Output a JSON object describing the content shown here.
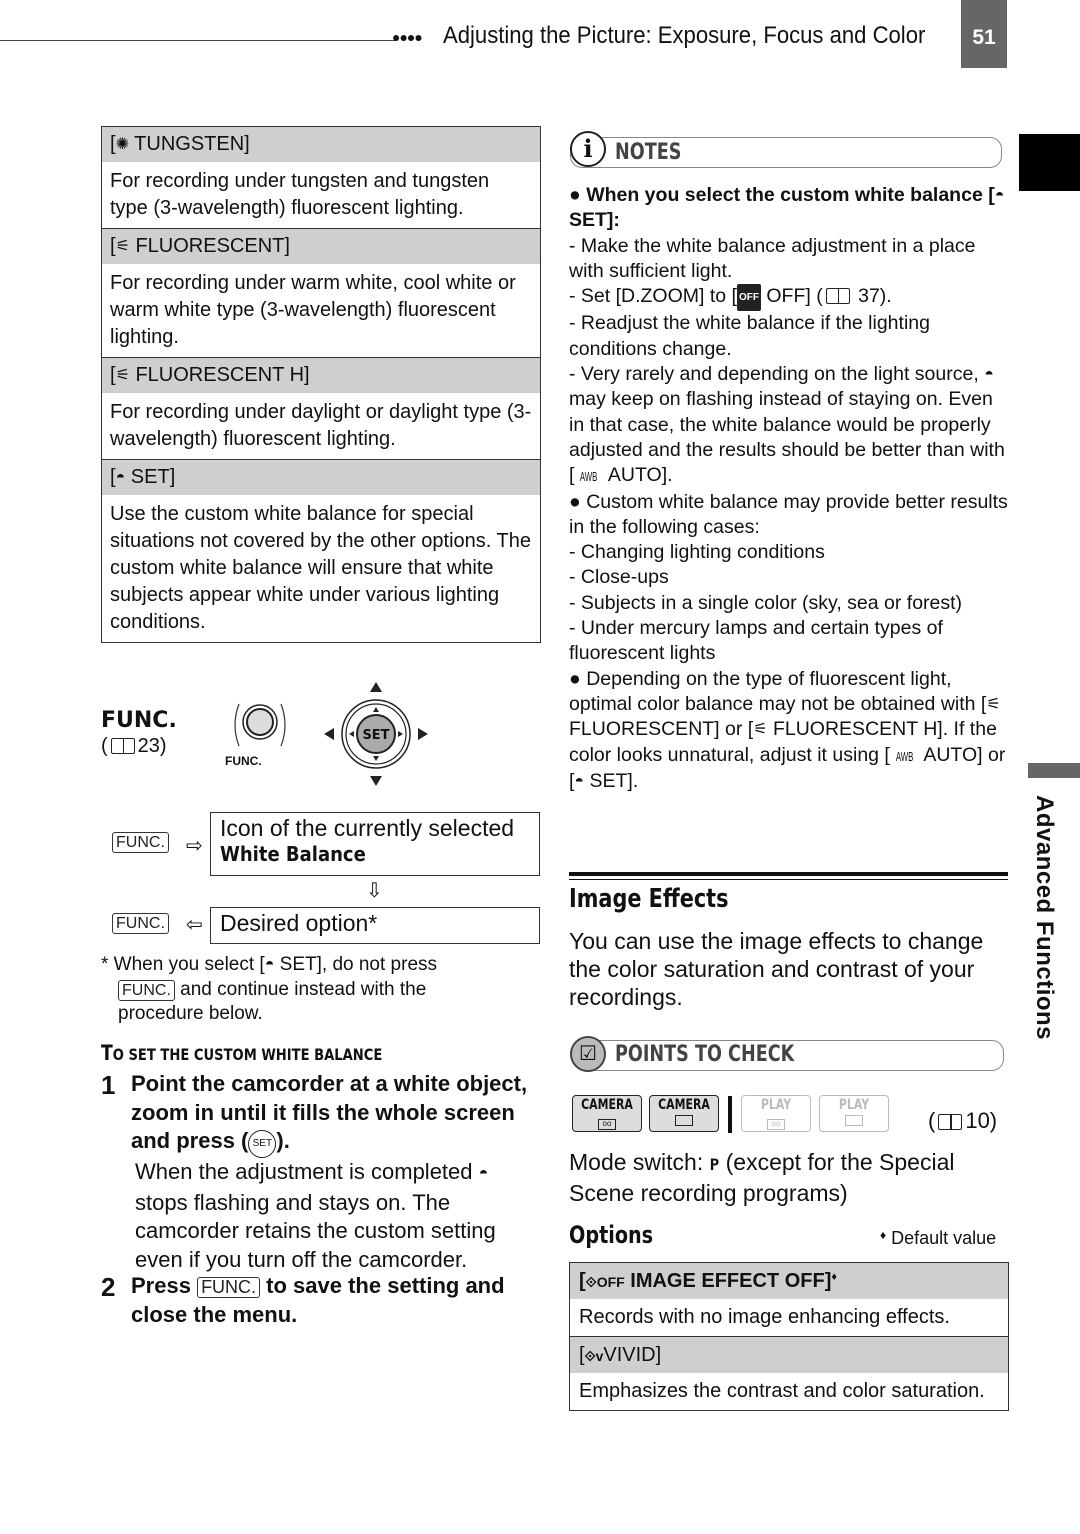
{
  "header": {
    "dots": "●●●●",
    "section_title": "Adjusting the Picture: Exposure, Focus and Color",
    "page_number": "51"
  },
  "side_tab": {
    "label": "Advanced Functions"
  },
  "white_balance_options": [
    {
      "icon": "tungsten-icon",
      "icon_glyph": "✺",
      "label": "TUNGSTEN",
      "description": "For recording under tungsten and tungsten type (3-wavelength) fluorescent lighting."
    },
    {
      "icon": "fluorescent-icon",
      "icon_glyph": "⚟",
      "label": "FLUORESCENT",
      "description": "For recording under warm white, cool white or warm white type (3-wavelength) fluorescent lighting."
    },
    {
      "icon": "fluorescent-h-icon",
      "icon_glyph": "⚟",
      "label": "FLUORESCENT H",
      "description": "For recording under daylight or daylight type (3-wavelength) fluorescent lighting."
    },
    {
      "icon": "custom-wb-icon",
      "icon_glyph": "◓",
      "label": "SET",
      "description": "Use the custom white balance for special situations not covered by the other options. The custom white balance will ensure that white subjects appear white under various lighting conditions."
    }
  ],
  "func_section": {
    "title": "FUNC.",
    "ref_open": "(",
    "ref_page": "23)",
    "func_button_label": "FUNC.",
    "set_label": "SET",
    "flow": {
      "kbd": "FUNC.",
      "box1_line1": "Icon of the currently selected",
      "box1_line2": "White Balance",
      "box2": "Desired option*",
      "arrow_right": "⇨",
      "arrow_down": "⇩",
      "arrow_left": "⇦"
    },
    "footnote_pre": "* When you select [",
    "footnote_mid": " SET], do not press",
    "footnote_kbd": "FUNC.",
    "footnote_post": " and continue instead with the",
    "footnote_end": "procedure below."
  },
  "procedure": {
    "title_big": "T",
    "title_rest": "O SET THE CUSTOM WHITE BALANCE",
    "steps": [
      {
        "num": "1",
        "text_pre": "Point the camcorder at a white object, zoom in until it fills the whole screen and press (",
        "text_set": "SET",
        "text_post": ").",
        "sub_pre": "When the adjustment is completed ",
        "sub_post": " stops flashing and stays on. The camcorder retains the custom setting even if you turn off the camcorder."
      },
      {
        "num": "2",
        "text_pre": "Press ",
        "kbd": "FUNC.",
        "text_post": " to save the setting and close the menu."
      }
    ]
  },
  "notes": {
    "title": "NOTES",
    "items": [
      {
        "type": "bullet-bold",
        "text_pre": "● When you select the custom white balance [",
        "text_post": " SET]:"
      },
      {
        "type": "dash",
        "text": "-  Make the white balance adjustment in a place with sufficient light."
      },
      {
        "type": "dash-off",
        "text_pre": "-  Set [D.ZOOM] to [",
        "off_badge": "OFF",
        "text_mid": " OFF] (",
        "text_post": " 37)."
      },
      {
        "type": "dash",
        "text": "-  Readjust the white balance if the lighting conditions change."
      },
      {
        "type": "dash-icon",
        "text_pre": "-  Very rarely and depending on the light source, ",
        "text_post": " may keep on flashing instead of staying on. Even in that case, the white balance would be properly adjusted and the results should be better than with [",
        "awb": "AWB",
        "text_end": " AUTO]."
      },
      {
        "type": "bullet",
        "text": "● Custom white balance may provide better results in the following cases:"
      },
      {
        "type": "dash",
        "text": "-  Changing lighting conditions"
      },
      {
        "type": "dash",
        "text": "-  Close-ups"
      },
      {
        "type": "dash",
        "text": "-  Subjects in a single color (sky, sea or forest)"
      },
      {
        "type": "dash",
        "text": "-  Under mercury lamps and certain types of fluorescent lights"
      },
      {
        "type": "bullet-fl",
        "text_pre": "● Depending on the type of fluorescent light, optimal color balance may not be obtained with [",
        "fl1": " FLUORESCENT] or [",
        "fl2": " FLUORESCENT H]. If the color looks unnatural, adjust it using [",
        "awb": "AWB",
        "auto": " AUTO] or [",
        "set": " SET]."
      }
    ]
  },
  "image_effects": {
    "title": "Image Effects",
    "description": "You can use the image effects to change the color saturation and contrast of your recordings.",
    "points_to_check": "POINTS TO CHECK",
    "modes": [
      {
        "label": "CAMERA",
        "media": "tape",
        "active": true
      },
      {
        "label": "CAMERA",
        "media": "card",
        "active": true
      },
      {
        "label": "PLAY",
        "media": "tape",
        "active": false
      },
      {
        "label": "PLAY",
        "media": "card",
        "active": false
      }
    ],
    "mode_ref_open": "(",
    "mode_ref_page": "10)",
    "mode_switch_pre": "Mode switch: ",
    "mode_switch_p": "P",
    "mode_switch_post": " (except for the Special Scene recording programs)",
    "options_title": "Options",
    "default_marker": "♦",
    "default_label": " Default value",
    "options": [
      {
        "icon": "image-effect-off-icon",
        "icon_text": "⟐OFF",
        "label": "IMAGE EFFECT OFF]",
        "default": true,
        "description": "Records with no image enhancing effects."
      },
      {
        "icon": "vivid-icon",
        "icon_text": "⟐v",
        "label": "VIVID]",
        "default": false,
        "description": "Emphasizes the contrast and color saturation."
      }
    ]
  }
}
